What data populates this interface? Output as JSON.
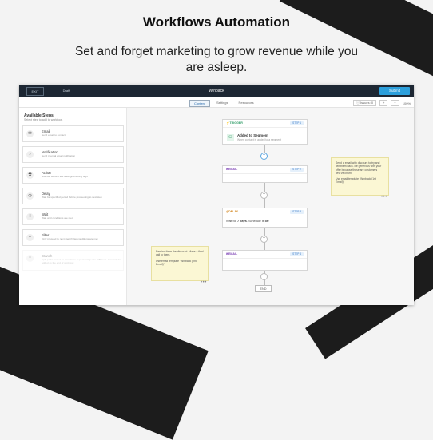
{
  "hero": {
    "title": "Workflows Automation",
    "subtitle": "Set and forget marketing to grow revenue while you are asleep."
  },
  "topbar": {
    "exit_label": "EXIT",
    "draft_label": "Draft",
    "workflow_title": "Winback",
    "submit_label": "Submit"
  },
  "tabs": [
    {
      "label": "Content",
      "active": true
    },
    {
      "label": "Settings",
      "active": false
    },
    {
      "label": "Resources",
      "active": false
    }
  ],
  "tools": {
    "issues_label": "Issues: 0",
    "zoom": "100%"
  },
  "sidebar": {
    "title": "Available Steps",
    "subtitle": "Select step to add to workflow.",
    "steps": [
      {
        "name": "Email",
        "desc": "Send email to contact",
        "icon": "envelope-icon",
        "glyph": "✉",
        "enabled": true
      },
      {
        "name": "Notification",
        "desc": "Send internal email notification",
        "icon": "bell-icon",
        "glyph": "🔔",
        "enabled": true
      },
      {
        "name": "Action",
        "desc": "Execute actions like adding/removing tags",
        "icon": "tool-icon",
        "glyph": "⚒",
        "enabled": true
      },
      {
        "name": "Delay",
        "desc": "Wait for specified period before proceeding to next step",
        "icon": "stopwatch-icon",
        "glyph": "⏱",
        "enabled": true
      },
      {
        "name": "Wait",
        "desc": "Wait until conditions are met",
        "icon": "pause-icon",
        "glyph": "⏸",
        "enabled": true
      },
      {
        "name": "Filter",
        "desc": "Only proceed to next step if filter conditions are met",
        "icon": "funnel-icon",
        "glyph": "▼",
        "enabled": true
      },
      {
        "name": "Branch",
        "desc": "Split paths based on conditions or percentage like A/B tests. Can only be added as the end of workflow.",
        "icon": "branch-icon",
        "glyph": "⑂",
        "enabled": false
      }
    ]
  },
  "canvas": {
    "trigger": {
      "type": "TRIGGER",
      "badge": "STEP 1",
      "title": "Added to Segment",
      "desc": "When contact is added to a segment"
    },
    "email1": {
      "type": "EMAIL",
      "badge": "STEP 2"
    },
    "delay": {
      "type": "DELAY",
      "badge": "STEP 3",
      "text_pre": "Wait for ",
      "text_bold": "7 days",
      "text_mid": ". Schedule is ",
      "text_off": "off"
    },
    "email2": {
      "type": "EMAIL",
      "badge": "STEP 4"
    },
    "end_label": "END",
    "notes": [
      {
        "line1": "Send a email with discount to try and win them back. Be generous with your offer because these are customers who've churn.",
        "line2": "Use email template \"Winback (1st Email)\""
      },
      {
        "line1": "Remind them the discount. Make a final call to them.",
        "line2": "Use email template \"Winback (2nd Email)\""
      }
    ]
  }
}
